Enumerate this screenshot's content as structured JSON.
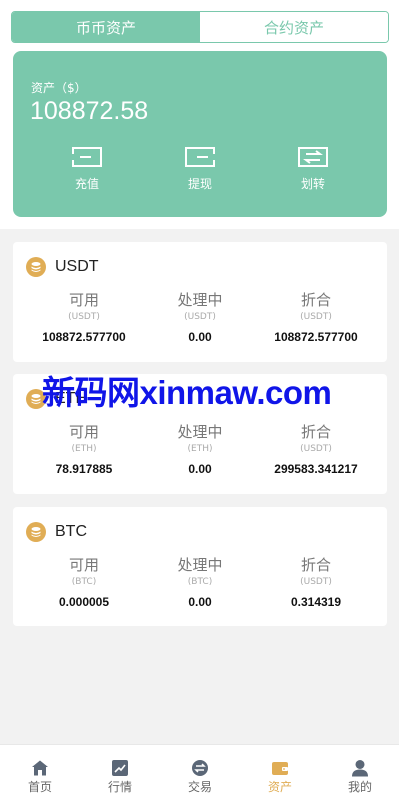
{
  "tabs": [
    {
      "label": "币币资产",
      "active": true
    },
    {
      "label": "合约资产",
      "active": false
    }
  ],
  "summary": {
    "label": "资产（$）",
    "total": "108872.58",
    "actions": [
      {
        "label": "充值",
        "icon": "deposit-icon"
      },
      {
        "label": "提现",
        "icon": "withdraw-icon"
      },
      {
        "label": "划转",
        "icon": "transfer-icon"
      }
    ]
  },
  "coins": [
    {
      "name": "USDT",
      "columns": [
        {
          "title": "可用",
          "unit": "(USDT)",
          "value": "108872.577700"
        },
        {
          "title": "处理中",
          "unit": "(USDT)",
          "value": "0.00"
        },
        {
          "title": "折合",
          "unit": "(USDT)",
          "value": "108872.577700"
        }
      ]
    },
    {
      "name": "ETH",
      "columns": [
        {
          "title": "可用",
          "unit": "(ETH)",
          "value": "78.917885"
        },
        {
          "title": "处理中",
          "unit": "(ETH)",
          "value": "0.00"
        },
        {
          "title": "折合",
          "unit": "(USDT)",
          "value": "299583.341217"
        }
      ]
    },
    {
      "name": "BTC",
      "columns": [
        {
          "title": "可用",
          "unit": "(BTC)",
          "value": "0.000005"
        },
        {
          "title": "处理中",
          "unit": "(BTC)",
          "value": "0.00"
        },
        {
          "title": "折合",
          "unit": "(USDT)",
          "value": "0.314319"
        }
      ]
    }
  ],
  "watermark": "新码网xinmaw.com",
  "tabbar": [
    {
      "label": "首页",
      "icon": "home-icon",
      "active": false
    },
    {
      "label": "行情",
      "icon": "market-chart-icon",
      "active": false
    },
    {
      "label": "交易",
      "icon": "trade-exchange-icon",
      "active": false
    },
    {
      "label": "资产",
      "icon": "wallet-icon",
      "active": true
    },
    {
      "label": "我的",
      "icon": "user-profile-icon",
      "active": false
    }
  ],
  "colors": {
    "accent": "#7ac8ac",
    "coin": "#e0ad55",
    "tab_active": "#e0ad55",
    "watermark": "#1015e8"
  }
}
